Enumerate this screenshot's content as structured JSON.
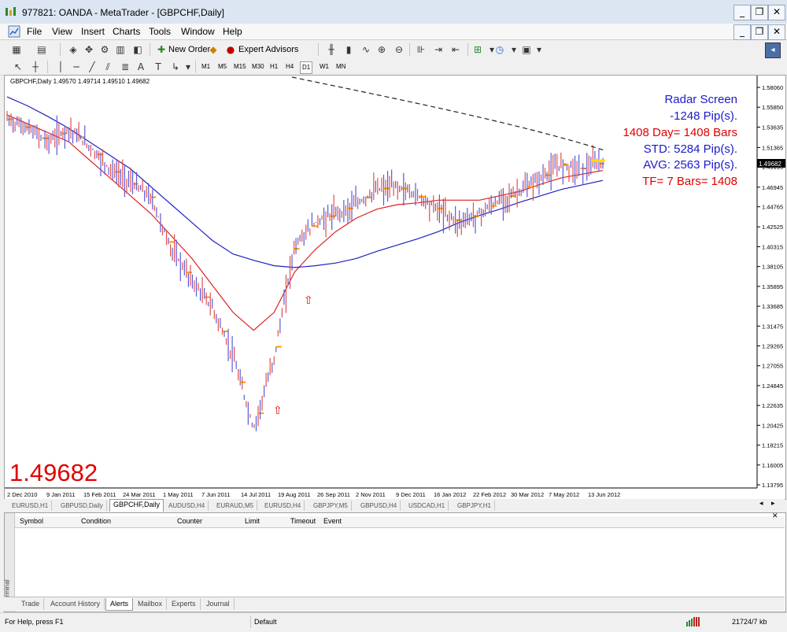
{
  "window": {
    "title": "977821: OANDA - MetaTrader - [GBPCHF,Daily]",
    "minimize": "_",
    "restore": "❐",
    "close": "✕"
  },
  "menu": [
    "File",
    "View",
    "Insert",
    "Charts",
    "Tools",
    "Window",
    "Help"
  ],
  "toolbar": {
    "new_order": "New Order",
    "expert_advisors": "Expert Advisors",
    "timeframes": [
      "M1",
      "M5",
      "M15",
      "M30",
      "H1",
      "H4",
      "D1",
      "W1",
      "MN"
    ],
    "active_timeframe": "D1"
  },
  "chart": {
    "header": "GBPCHF,Daily  1.49570 1.49714 1.49510 1.49682",
    "big_price": "1.49682",
    "current_price_label": "1.49682",
    "radar": {
      "line1": "Radar Screen",
      "line2": "-1248 Pip(s).",
      "line3": "1408 Day= 1408 Bars",
      "line4": "STD: 5284 Pip(s).",
      "line5": "AVG: 2563 Pip(s).",
      "line6": "TF= 7 Bars= 1408"
    },
    "colors": {
      "blue_text": "#1a1acc",
      "red_text": "#e00000",
      "candles": "#6060e0",
      "ema": "#e02020",
      "sma": "#2020c0",
      "markers": "#ff9900"
    }
  },
  "chart_data": {
    "type": "line",
    "title": "GBPCHF,Daily",
    "x": [
      "2 Dec 2010",
      "9 Jan 2011",
      "15 Feb 2011",
      "24 Mar 2011",
      "1 May 2011",
      "7 Jun 2011",
      "14 Jul 2011",
      "19 Aug 2011",
      "26 Sep 2011",
      "2 Nov 2011",
      "9 Dec 2011",
      "16 Jan 2012",
      "22 Feb 2012",
      "30 Mar 2012",
      "7 May 2012",
      "13 Jun 2012"
    ],
    "y_ticks": [
      "1.58060",
      "1.55850",
      "1.53635",
      "1.51365",
      "1.49195",
      "1.46945",
      "1.44765",
      "1.42525",
      "1.40315",
      "1.38105",
      "1.35895",
      "1.33685",
      "1.31475",
      "1.29265",
      "1.27055",
      "1.24845",
      "1.22635",
      "1.20425",
      "1.18215",
      "1.16005",
      "1.13795"
    ],
    "ylim": [
      1.13795,
      1.5806
    ],
    "series": [
      {
        "name": "",
        "values": [
          1.545,
          1.535,
          1.52,
          1.535,
          1.515,
          1.49,
          1.475,
          1.458,
          1.4,
          1.365,
          1.335,
          1.28,
          1.2,
          1.28,
          1.405,
          1.43,
          1.44,
          1.45,
          1.467,
          1.47,
          1.46,
          1.445,
          1.43,
          1.44,
          1.455,
          1.465,
          1.48,
          1.495,
          1.49,
          1.497
        ]
      },
      {
        "name": "",
        "values": [
          1.55,
          1.54,
          1.53,
          1.52,
          1.5,
          1.48,
          1.46,
          1.44,
          1.415,
          1.39,
          1.36,
          1.33,
          1.31,
          1.33,
          1.375,
          1.4,
          1.42,
          1.435,
          1.445,
          1.45,
          1.452,
          1.455,
          1.455,
          1.455,
          1.46,
          1.465,
          1.473,
          1.48,
          1.484,
          1.488
        ]
      },
      {
        "name": "",
        "values": [
          1.57,
          1.56,
          1.548,
          1.535,
          1.52,
          1.505,
          1.49,
          1.47,
          1.45,
          1.43,
          1.41,
          1.395,
          1.388,
          1.382,
          1.38,
          1.382,
          1.385,
          1.39,
          1.398,
          1.405,
          1.412,
          1.42,
          1.43,
          1.438,
          1.445,
          1.453,
          1.46,
          1.467,
          1.472,
          1.477
        ]
      }
    ]
  },
  "symbol_tabs": [
    "EURUSD,H1",
    "GBPUSD,Daily",
    "GBPCHF,Daily",
    "AUDUSD,H4",
    "EURAUD,M5",
    "EURUSD,H4",
    "GBPJPY,M5",
    "GBPUSD,H4",
    "USDCAD,H1",
    "GBPJPY,H1"
  ],
  "active_symbol_tab": "GBPCHF,Daily",
  "terminal": {
    "side_label": "Terminal",
    "columns": [
      "Symbol",
      "Condition",
      "Counter",
      "Limit",
      "Timeout",
      "Event"
    ],
    "tabs": [
      "Trade",
      "Account History",
      "Alerts",
      "Mailbox",
      "Experts",
      "Journal"
    ],
    "active_tab": "Alerts"
  },
  "status": {
    "help": "For Help, press F1",
    "profile": "Default",
    "traffic": "21724/7 kb"
  }
}
